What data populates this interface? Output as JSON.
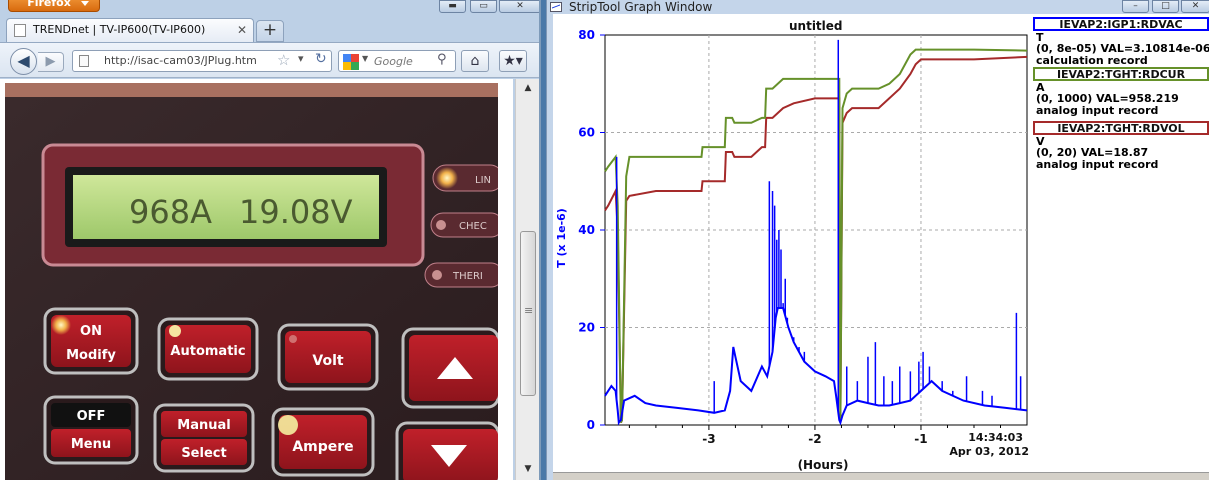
{
  "firefox": {
    "app_menu_label": "Firefox",
    "tab": {
      "title": "TRENDnet | TV-IP600(TV-IP600)"
    },
    "new_tab_label": "+",
    "url": "http://isac-cam03/JPlug.htm",
    "search": {
      "engine_label": "Google",
      "placeholder": "Google"
    },
    "video": {
      "display_current": "968A",
      "display_voltage": "19.08V",
      "indicators": [
        "LIN",
        "CHEC",
        "THERI"
      ],
      "buttons": [
        {
          "line1": "ON",
          "line2": "Modify"
        },
        {
          "line1": "Automatic"
        },
        {
          "line1": "Volt"
        },
        {
          "line1": "OFF",
          "line2": "Menu"
        },
        {
          "line1": "Manual",
          "line2": "Select"
        },
        {
          "line1": "Ampere"
        }
      ]
    }
  },
  "striptool": {
    "window_title": "StripTool Graph Window",
    "caption_buttons": [
      "–",
      "□",
      "✕"
    ],
    "legend": [
      {
        "name": "IEVAP2:IGP1:RDVAC",
        "unit": "T",
        "range_val": "(0, 8e-05)  VAL=3.10814e-06",
        "desc": "calculation record",
        "color": "#0000ff"
      },
      {
        "name": "IEVAP2:TGHT:RDCUR",
        "unit": "A",
        "range_val": "(0, 1000)  VAL=958.219",
        "desc": "analog input record",
        "color": "#66912a"
      },
      {
        "name": "IEVAP2:TGHT:RDVOL",
        "unit": "V",
        "range_val": "(0, 20)  VAL=18.87",
        "desc": "analog input record",
        "color": "#a52a2a"
      }
    ]
  },
  "chart_data": {
    "type": "line",
    "title": "untitled",
    "ylabel": "T (x 1e-6)",
    "xlabel": "(Hours)",
    "time_label": "14:34:03",
    "date_label": "Apr 03, 2012",
    "ylim": [
      0,
      80
    ],
    "xlim": [
      -3.98,
      0
    ],
    "y_ticks": [
      0,
      20,
      40,
      60,
      80
    ],
    "x_ticks": [
      -3,
      -2,
      -1
    ],
    "grid": true,
    "series": [
      {
        "name": "IEVAP2:IGP1:RDVAC",
        "color": "#0000ff",
        "x": [
          -3.98,
          -3.92,
          -3.88,
          -3.86,
          -3.85,
          -3.84,
          -3.83,
          -3.8,
          -3.7,
          -3.6,
          -3.5,
          -3.3,
          -3.1,
          -2.95,
          -2.85,
          -2.8,
          -2.77,
          -2.75,
          -2.7,
          -2.6,
          -2.5,
          -2.45,
          -2.4,
          -2.37,
          -2.35,
          -2.3,
          -2.25,
          -2.2,
          -2.1,
          -2.0,
          -1.9,
          -1.82,
          -1.8,
          -1.77,
          -1.76,
          -1.74,
          -1.7,
          -1.6,
          -1.5,
          -1.4,
          -1.3,
          -1.2,
          -1.1,
          -1.0,
          -0.9,
          -0.8,
          -0.6,
          -0.4,
          -0.2,
          0
        ],
        "y": [
          6,
          8,
          7,
          3,
          0.5,
          0.8,
          1,
          5,
          6,
          4.5,
          4,
          3.5,
          3,
          2.5,
          3,
          7,
          16,
          14,
          9,
          7,
          12,
          10,
          15,
          22,
          24,
          24,
          20,
          17,
          13,
          11,
          10,
          9,
          6,
          1,
          0.5,
          2,
          4,
          5,
          4.5,
          4,
          4,
          4.5,
          5,
          7,
          9,
          7,
          5,
          4,
          3.5,
          3
        ]
      },
      {
        "name": "IEVAP2:TGHT:RDCUR",
        "color": "#66912a",
        "x": [
          -3.98,
          -3.95,
          -3.88,
          -3.86,
          -3.83,
          -3.82,
          -3.78,
          -3.75,
          -3.5,
          -3.3,
          -3.07,
          -3.06,
          -2.85,
          -2.84,
          -2.78,
          -2.76,
          -2.6,
          -2.5,
          -2.47,
          -2.46,
          -2.4,
          -2.35,
          -2.3,
          -2.2,
          -2.0,
          -1.8,
          -1.77,
          -1.76,
          -1.74,
          -1.7,
          -1.65,
          -1.4,
          -1.3,
          -1.2,
          -1.1,
          -1.05,
          -1.0,
          -0.5,
          0
        ],
        "y": [
          52,
          53,
          55,
          45,
          0.5,
          1,
          51,
          55,
          55,
          55,
          55,
          57,
          57,
          63,
          63,
          62,
          62,
          63,
          63,
          69,
          69,
          70,
          71,
          71,
          71,
          71,
          71,
          0.5,
          65,
          68,
          69,
          69,
          70,
          72,
          76,
          77,
          77,
          77,
          76.8
        ]
      },
      {
        "name": "IEVAP2:TGHT:RDVOL",
        "color": "#a52a2a",
        "x": [
          -3.98,
          -3.95,
          -3.88,
          -3.86,
          -3.83,
          -3.82,
          -3.78,
          -3.75,
          -3.5,
          -3.3,
          -3.07,
          -3.06,
          -2.85,
          -2.84,
          -2.78,
          -2.76,
          -2.6,
          -2.5,
          -2.47,
          -2.46,
          -2.4,
          -2.35,
          -2.3,
          -2.2,
          -2.0,
          -1.8,
          -1.77,
          -1.76,
          -1.74,
          -1.7,
          -1.65,
          -1.4,
          -1.3,
          -1.2,
          -1.1,
          -1.05,
          -1.0,
          -0.5,
          0
        ],
        "y": [
          44,
          45,
          48,
          40,
          0.5,
          1,
          46,
          47,
          48,
          48,
          48,
          50,
          50,
          56,
          56,
          55,
          55,
          57,
          57,
          63,
          63,
          64,
          65,
          66,
          67,
          67,
          67,
          0.5,
          62,
          64,
          65,
          65,
          67,
          69,
          72,
          74,
          75,
          75,
          75.5
        ]
      }
    ],
    "spikes": {
      "series": "IEVAP2:IGP1:RDVAC",
      "x": [
        -3.87,
        -2.95,
        -2.76,
        -2.43,
        -2.4,
        -2.38,
        -2.36,
        -2.34,
        -2.32,
        -2.3,
        -2.28,
        -2.26,
        -2.2,
        -2.15,
        -2.1,
        -1.78,
        -1.7,
        -1.6,
        -1.5,
        -1.43,
        -1.35,
        -1.27,
        -1.2,
        -1.1,
        -1.02,
        -0.98,
        -0.92,
        -0.8,
        -0.7,
        -0.57,
        -0.42,
        -0.33,
        -0.1,
        -0.06
      ],
      "y": [
        55,
        9,
        15,
        50,
        48,
        45,
        38,
        40,
        36,
        25,
        30,
        22,
        18,
        16,
        15,
        79,
        12,
        9,
        14,
        17,
        10,
        9,
        12,
        11,
        13,
        15,
        12,
        9,
        7,
        10,
        7,
        6,
        23,
        10
      ]
    }
  }
}
